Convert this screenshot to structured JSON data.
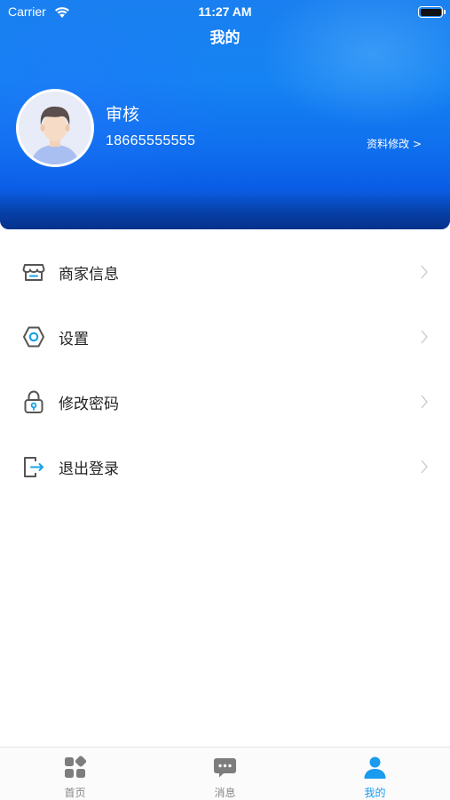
{
  "status_bar": {
    "carrier": "Carrier",
    "time": "11:27 AM",
    "wifi_icon": "wifi-icon",
    "battery_icon": "battery-icon"
  },
  "header": {
    "title": "我的"
  },
  "profile": {
    "avatar_icon": "avatar-icon",
    "name": "审核",
    "phone": "18665555555",
    "edit_label": "资料修改 >"
  },
  "menu": [
    {
      "label": "商家信息",
      "icon": "store-icon"
    },
    {
      "label": "设置",
      "icon": "settings-icon"
    },
    {
      "label": "修改密码",
      "icon": "lock-icon"
    },
    {
      "label": "退出登录",
      "icon": "logout-icon"
    }
  ],
  "tabbar": {
    "tabs": [
      {
        "label": "首页",
        "icon": "home-grid-icon",
        "active": false
      },
      {
        "label": "消息",
        "icon": "chat-bubble-icon",
        "active": false
      },
      {
        "label": "我的",
        "icon": "user-icon",
        "active": true
      }
    ]
  },
  "colors": {
    "accent": "#1a9bf0",
    "header_blue": "#1583f3",
    "icon_gray": "#555555"
  }
}
